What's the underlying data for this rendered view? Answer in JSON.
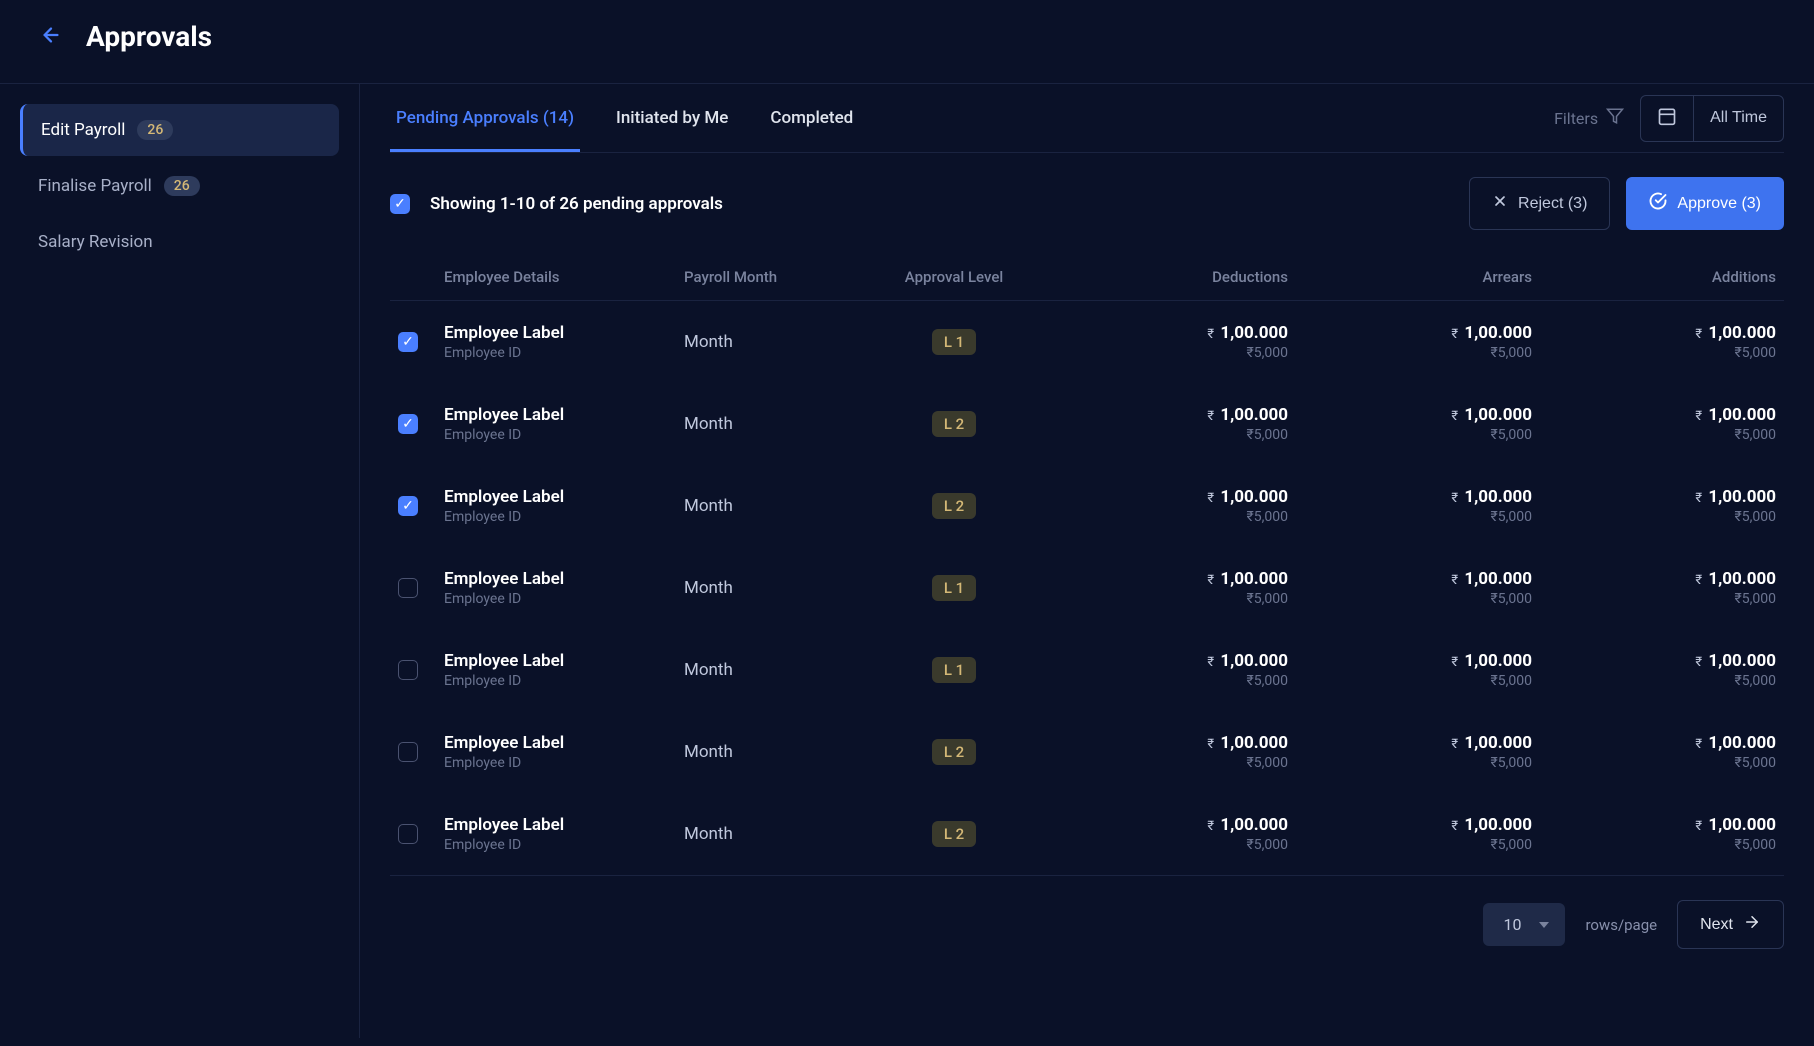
{
  "header": {
    "title": "Approvals"
  },
  "sidebar": {
    "items": [
      {
        "label": "Edit Payroll",
        "badge": "26",
        "active": true
      },
      {
        "label": "Finalise Payroll",
        "badge": "26",
        "active": false
      },
      {
        "label": "Salary Revision",
        "badge": "",
        "active": false
      }
    ]
  },
  "tabs": [
    {
      "label": "Pending Approvals (14)",
      "active": true
    },
    {
      "label": "Initiated by Me",
      "active": false
    },
    {
      "label": "Completed",
      "active": false
    }
  ],
  "filters_label": "Filters",
  "date_label": "All Time",
  "summary": "Showing 1-10 of 26 pending  approvals",
  "reject_label": "Reject (3)",
  "approve_label": "Approve (3)",
  "columns": {
    "employee": "Employee Details",
    "month": "Payroll Month",
    "level": "Approval Level",
    "deductions": "Deductions",
    "arrears": "Arrears",
    "additions": "Additions"
  },
  "rows": [
    {
      "checked": true,
      "label": "Employee Label",
      "id": "Employee ID",
      "month": "Month",
      "level": "L 1",
      "deductions": {
        "main": "1,00.000",
        "sub": "₹5,000"
      },
      "arrears": {
        "main": "1,00.000",
        "sub": "₹5,000"
      },
      "additions": {
        "main": "1,00.000",
        "sub": "₹5,000"
      }
    },
    {
      "checked": true,
      "label": "Employee Label",
      "id": "Employee ID",
      "month": "Month",
      "level": "L 2",
      "deductions": {
        "main": "1,00.000",
        "sub": "₹5,000"
      },
      "arrears": {
        "main": "1,00.000",
        "sub": "₹5,000"
      },
      "additions": {
        "main": "1,00.000",
        "sub": "₹5,000"
      }
    },
    {
      "checked": true,
      "label": "Employee Label",
      "id": "Employee ID",
      "month": "Month",
      "level": "L 2",
      "deductions": {
        "main": "1,00.000",
        "sub": "₹5,000"
      },
      "arrears": {
        "main": "1,00.000",
        "sub": "₹5,000"
      },
      "additions": {
        "main": "1,00.000",
        "sub": "₹5,000"
      }
    },
    {
      "checked": false,
      "label": "Employee Label",
      "id": "Employee ID",
      "month": "Month",
      "level": "L 1",
      "deductions": {
        "main": "1,00.000",
        "sub": "₹5,000"
      },
      "arrears": {
        "main": "1,00.000",
        "sub": "₹5,000"
      },
      "additions": {
        "main": "1,00.000",
        "sub": "₹5,000"
      }
    },
    {
      "checked": false,
      "label": "Employee Label",
      "id": "Employee ID",
      "month": "Month",
      "level": "L 1",
      "deductions": {
        "main": "1,00.000",
        "sub": "₹5,000"
      },
      "arrears": {
        "main": "1,00.000",
        "sub": "₹5,000"
      },
      "additions": {
        "main": "1,00.000",
        "sub": "₹5,000"
      }
    },
    {
      "checked": false,
      "label": "Employee Label",
      "id": "Employee ID",
      "month": "Month",
      "level": "L 2",
      "deductions": {
        "main": "1,00.000",
        "sub": "₹5,000"
      },
      "arrears": {
        "main": "1,00.000",
        "sub": "₹5,000"
      },
      "additions": {
        "main": "1,00.000",
        "sub": "₹5,000"
      }
    },
    {
      "checked": false,
      "label": "Employee Label",
      "id": "Employee ID",
      "month": "Month",
      "level": "L 2",
      "deductions": {
        "main": "1,00.000",
        "sub": "₹5,000"
      },
      "arrears": {
        "main": "1,00.000",
        "sub": "₹5,000"
      },
      "additions": {
        "main": "1,00.000",
        "sub": "₹5,000"
      }
    }
  ],
  "pagination": {
    "page_size": "10",
    "rows_label": "rows/page",
    "next_label": "Next"
  },
  "currency_symbol": "₹"
}
